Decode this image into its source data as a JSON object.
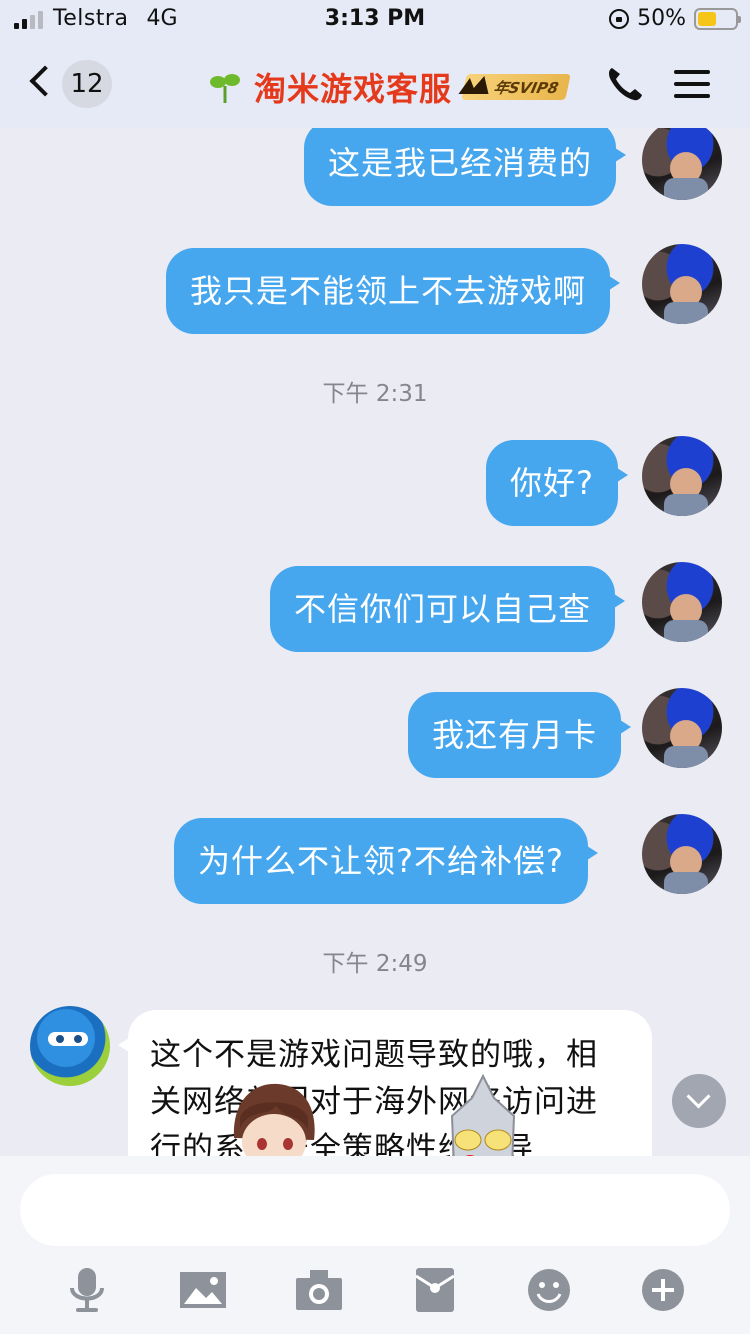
{
  "status_bar": {
    "carrier": "Telstra",
    "network": "4G",
    "time": "3:13 PM",
    "battery_percent_label": "50%",
    "battery_level": 0.5,
    "signal_bars": 2
  },
  "nav": {
    "unread_count": "12",
    "title": "淘米游戏客服",
    "svip_label": "年SVIP8",
    "title_color": "#e5391c"
  },
  "messages": {
    "m1": "这是我已经消费的",
    "m2": "我只是不能领上不去游戏啊",
    "ts1": "下午 2:31",
    "m3": "你好?",
    "m4": "不信你们可以自己查",
    "m5": "我还有月卡",
    "m6": "为什么不让领?不给补偿?",
    "ts2": "下午 2:49",
    "reply_line1": "这个不是游戏问题导致的哦，相",
    "reply_line2": "关网络部门对于海外网络访问进",
    "reply_line3": "行的系统安全策略性维护导"
  },
  "colors": {
    "outgoing_bubble": "#47a7ee",
    "background": "#ebebf3"
  },
  "toolbar": {
    "icons": [
      "microphone-icon",
      "image-icon",
      "camera-icon",
      "red-packet-icon",
      "emoji-icon",
      "plus-icon"
    ]
  }
}
